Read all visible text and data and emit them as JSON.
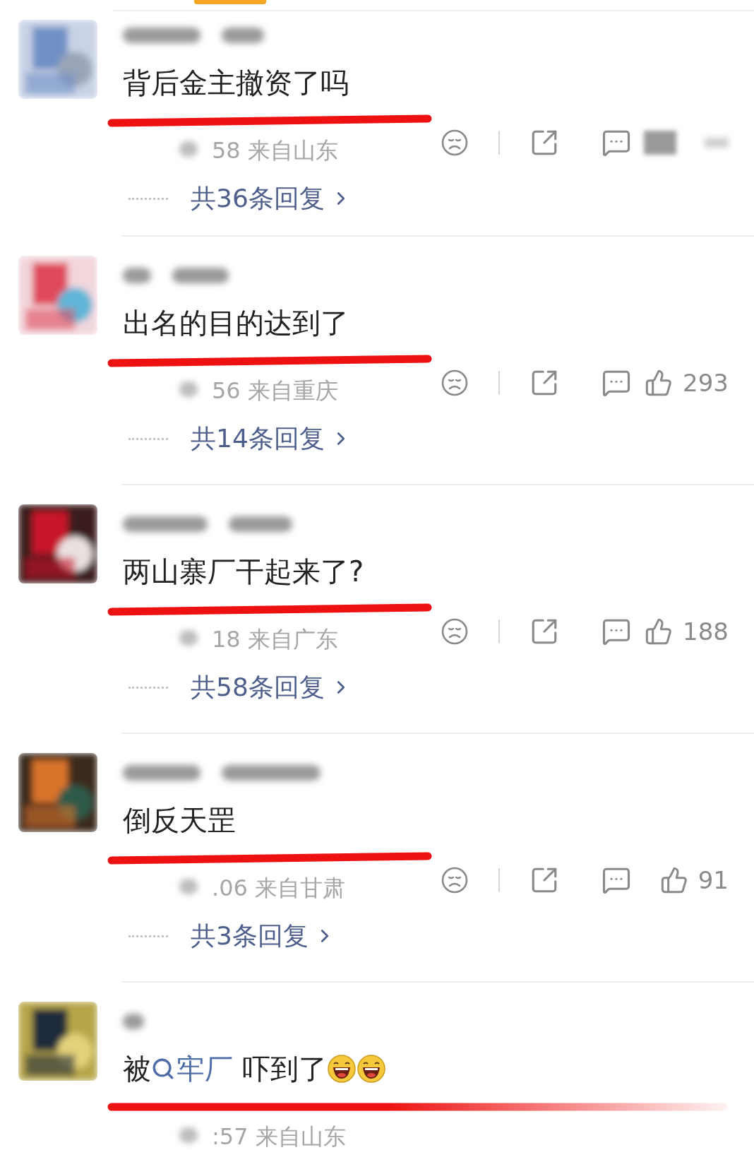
{
  "comments": [
    {
      "content": [
        {
          "kind": "text",
          "text": "背后金主撤资了吗"
        }
      ],
      "meta": "58 来自山东",
      "actions": {
        "likes_hidden": true
      },
      "replies": "共36条回复"
    },
    {
      "content": [
        {
          "kind": "text",
          "text": "出名的目的达到了"
        }
      ],
      "meta": "56 来自重庆",
      "actions": {
        "likes": "293"
      },
      "replies": "共14条回复"
    },
    {
      "content": [
        {
          "kind": "text",
          "text": "两山寨厂干起来了?"
        }
      ],
      "meta": "18 来自广东",
      "actions": {
        "likes": "188"
      },
      "replies": "共58条回复"
    },
    {
      "content": [
        {
          "kind": "text",
          "text": "倒反天罡"
        }
      ],
      "meta": ".06 来自甘肃",
      "actions": {
        "likes": "91"
      },
      "replies": "共3条回复"
    },
    {
      "content": [
        {
          "kind": "text",
          "text": "被"
        },
        {
          "kind": "search_link",
          "text": "牢厂"
        },
        {
          "kind": "text",
          "text": " 吓到了"
        },
        {
          "kind": "emoji"
        },
        {
          "kind": "emoji"
        }
      ],
      "meta": ":57 来自山东"
    }
  ]
}
